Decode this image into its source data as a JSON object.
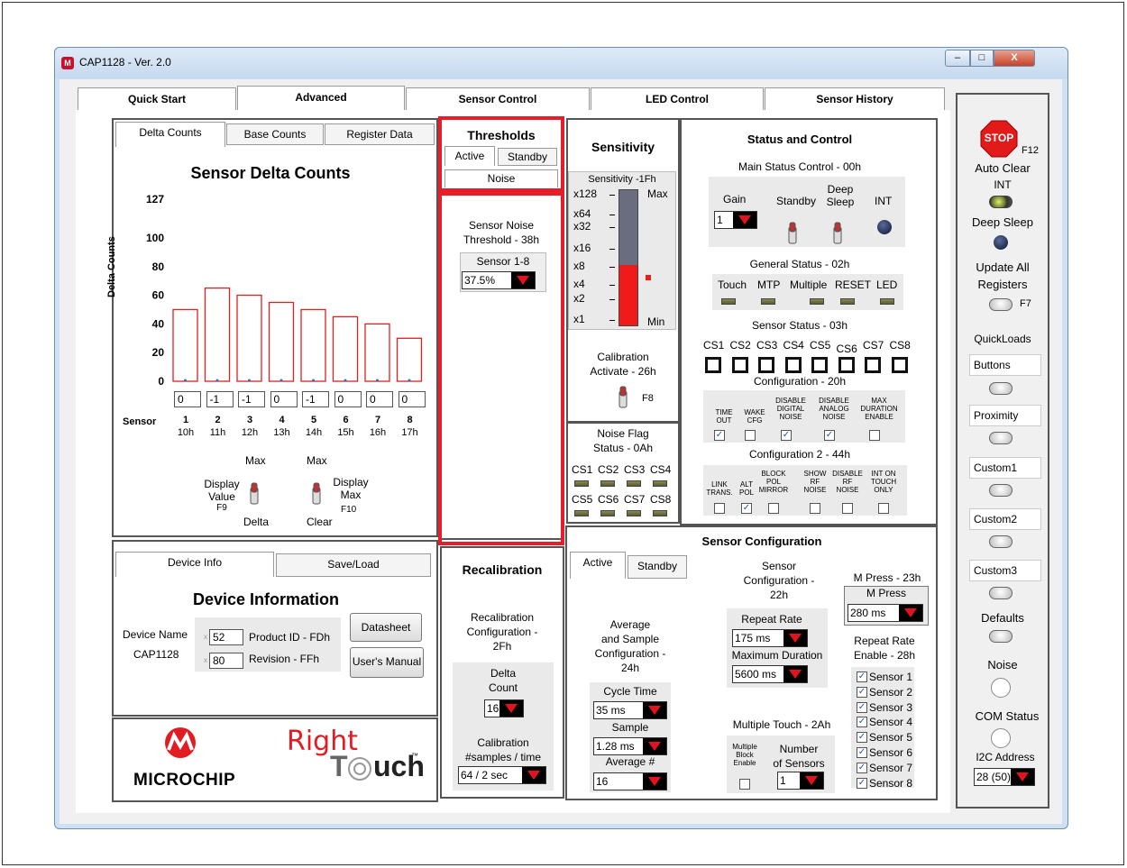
{
  "window": {
    "title": "CAP1128 - Ver. 2.0",
    "btn_min": "‒",
    "btn_max": "□",
    "btn_close": "X"
  },
  "main_tabs": [
    "Quick Start",
    "Advanced",
    "Sensor Control",
    "LED Control",
    "Sensor History"
  ],
  "delta_panel": {
    "tabs": [
      "Delta Counts",
      "Base Counts",
      "Register Data"
    ],
    "chart_title": "Sensor Delta Counts",
    "ylabel": "Delta Counts",
    "sensor_label": "Sensor",
    "values_boxes": [
      "0",
      "-1",
      "-1",
      "0",
      "-1",
      "0",
      "0",
      "0"
    ],
    "sensors": [
      "1",
      "2",
      "3",
      "4",
      "5",
      "6",
      "7",
      "8"
    ],
    "regs": [
      "10h",
      "11h",
      "12h",
      "13h",
      "14h",
      "15h",
      "16h",
      "17h"
    ],
    "max_label_1": "Max",
    "max_label_2": "Max",
    "display_value": "Display\nValue",
    "f9": "F9",
    "delta": "Delta",
    "display_max": "Display\nMax",
    "f10": "F10",
    "clear": "Clear"
  },
  "chart_data": {
    "type": "bar",
    "categories": [
      "1",
      "2",
      "3",
      "4",
      "5",
      "6",
      "7",
      "8"
    ],
    "values": [
      50,
      65,
      60,
      55,
      50,
      45,
      40,
      30
    ],
    "ylabel": "Delta Counts",
    "xlabel": "Sensor",
    "yticks": [
      "127",
      "100",
      "80",
      "60",
      "40",
      "20",
      "0"
    ],
    "ylim": [
      0,
      127
    ]
  },
  "thresholds": {
    "title": "Thresholds",
    "tabs": [
      "Active",
      "Standby"
    ],
    "noise_tab": "Noise",
    "label": "Sensor Noise\nThreshold - 38h",
    "sublabel": "Sensor 1-8",
    "value": "37.5%"
  },
  "sensitivity": {
    "title": "Sensitivity",
    "reg": "Sensitivity -1Fh",
    "levels": [
      "x128",
      "x64",
      "x32",
      "x16",
      "x8",
      "x4",
      "x2",
      "x1"
    ],
    "max": "Max",
    "min": "Min",
    "calib": "Calibration\nActivate - 26h",
    "f8": "F8"
  },
  "noise_flag": {
    "title": "Noise Flag\nStatus - 0Ah",
    "row1": [
      "CS1",
      "CS2",
      "CS3",
      "CS4"
    ],
    "row2": [
      "CS5",
      "CS6",
      "CS7",
      "CS8"
    ]
  },
  "status": {
    "title": "Status and Control",
    "main": "Main Status Control - 00h",
    "gain": "Gain",
    "gain_val": "1",
    "standby": "Standby",
    "deep_sleep": "Deep\nSleep",
    "int": "INT",
    "general": "General Status - 02h",
    "general_items": [
      "Touch",
      "MTP",
      "Multiple",
      "RESET",
      "LED"
    ],
    "sensor_status": "Sensor Status - 03h",
    "cs": [
      "CS1",
      "CS2",
      "CS3",
      "CS4",
      "CS5",
      "CS6",
      "CS7",
      "CS8"
    ],
    "config": "Configuration - 20h",
    "config_items": [
      "TIME\nOUT",
      "WAKE\nCFG",
      "DISABLE\nDIGITAL\nNOISE",
      "DISABLE\nANALOG\nNOISE",
      "MAX\nDURATION\nENABLE"
    ],
    "config_checks": [
      true,
      false,
      true,
      true,
      false
    ],
    "config2": "Configuration 2 - 44h",
    "config2_items": [
      "LINK\nTRANS.",
      "ALT\nPOL",
      "BLOCK\nPOL\nMIRROR",
      "SHOW\nRF\nNOISE",
      "DISABLE\nRF\nNOISE",
      "INT ON\nTOUCH\nONLY"
    ],
    "config2_checks": [
      false,
      true,
      false,
      false,
      false,
      false
    ]
  },
  "device": {
    "tabs": [
      "Device Info",
      "Save/Load"
    ],
    "title": "Device Information",
    "name_label": "Device Name",
    "name": "CAP1128",
    "pid_val": "52",
    "pid_label": "Product ID - FDh",
    "rev_val": "80",
    "rev_label": "Revision - FFh",
    "datasheet": "Datasheet",
    "manual": "User's Manual",
    "x": "x"
  },
  "logos": {
    "microchip": "MICROCHIP",
    "right": "Right",
    "touch": "T",
    "uch": "uch",
    "tm": "™"
  },
  "recal": {
    "title": "Recalibration",
    "cfg": "Recalibration\nConfiguration -\n2Fh",
    "delta": "Delta\nCount",
    "delta_val": "16",
    "cal": "Calibration\n#samples / time",
    "cal_val": "64 / 2 sec"
  },
  "sensor_config": {
    "title": "Sensor Configuration",
    "tabs": [
      "Active",
      "Standby"
    ],
    "avg": "Average\nand Sample\nConfiguration -\n24h",
    "cycle": "Cycle Time",
    "cycle_val": "35 ms",
    "sample": "Sample",
    "sample_val": "1.28 ms",
    "average": "Average #",
    "average_val": "16",
    "sc": "Sensor\nConfiguration -\n22h",
    "repeat": "Repeat Rate",
    "repeat_val": "175 ms",
    "maxdur": "Maximum Duration",
    "maxdur_val": "5600 ms",
    "mt": "Multiple Touch - 2Ah",
    "mbe": "Multiple\nBlock\nEnable",
    "nos": "Number\nof Sensors",
    "nos_val": "1",
    "mpress_reg": "M Press - 23h",
    "mpress": "M Press",
    "mpress_val": "280 ms",
    "rre": "Repeat Rate\nEnable - 28h",
    "rre_items": [
      "Sensor 1",
      "Sensor 2",
      "Sensor 3",
      "Sensor 4",
      "Sensor 5",
      "Sensor 6",
      "Sensor 7",
      "Sensor 8"
    ]
  },
  "right_panel": {
    "stop": "STOP",
    "f12": "F12",
    "auto_clear": "Auto Clear",
    "int": "INT",
    "deep_sleep": "Deep Sleep",
    "update_all": "Update All\nRegisters",
    "f7": "F7",
    "quickloads": "QuickLoads",
    "buttons": "Buttons",
    "proximity": "Proximity",
    "custom1": "Custom1",
    "custom2": "Custom2",
    "custom3": "Custom3",
    "defaults": "Defaults",
    "noise": "Noise",
    "com": "COM Status",
    "i2c": "I2C Address",
    "i2c_val": "28 (50)"
  }
}
